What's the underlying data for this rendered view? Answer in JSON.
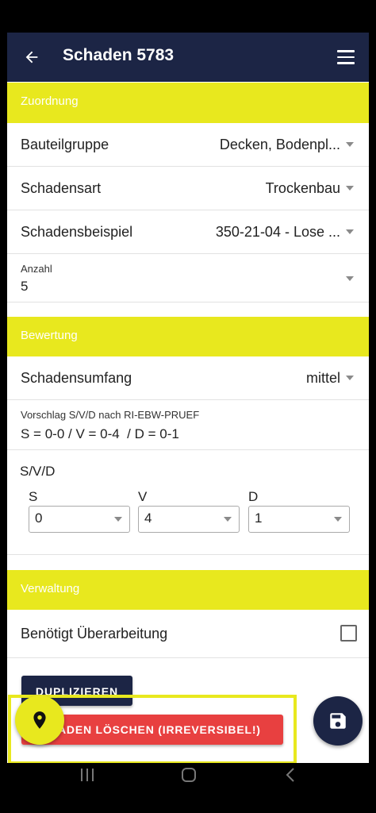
{
  "app_bar": {
    "back_icon": "arrow-left-icon",
    "title": "Schaden 5783",
    "menu_icon": "hamburger-menu-icon"
  },
  "sections": {
    "zuordnung": "Zuordnung",
    "bewertung": "Bewertung",
    "verwaltung": "Verwaltung"
  },
  "fields": {
    "bauteilgruppe": {
      "label": "Bauteilgruppe",
      "value": "Decken, Bodenpl..."
    },
    "schadensart": {
      "label": "Schadensart",
      "value": "Trockenbau"
    },
    "schadensbeispiel": {
      "label": "Schadensbeispiel",
      "value": "350-21-04 - Lose ..."
    },
    "anzahl": {
      "label": "Anzahl",
      "value": "5"
    },
    "schadensumfang": {
      "label": "Schadensumfang",
      "value": "mittel"
    },
    "vorschlag": {
      "label": "Vorschlag S/V/D nach RI-EBW-PRUEF",
      "value": "S = 0-0 / V = 0-4  / D = 0-1"
    },
    "svd": {
      "label": "S/V/D",
      "s": {
        "label": "S",
        "value": "0"
      },
      "v": {
        "label": "V",
        "value": "4"
      },
      "d": {
        "label": "D",
        "value": "1"
      }
    },
    "ueberarbeitung": {
      "label": "Benötigt Überarbeitung",
      "checked": false
    }
  },
  "buttons": {
    "duplicate": "DUPLIZIEREN",
    "delete": "ADEN LÖSCHEN (IRREVERSIBEL!)"
  },
  "fabs": {
    "location_icon": "location-pin-icon",
    "save_icon": "floppy-disk-icon"
  },
  "colors": {
    "primary": "#1c2545",
    "accent": "#e8e81e",
    "danger": "#e84040"
  }
}
